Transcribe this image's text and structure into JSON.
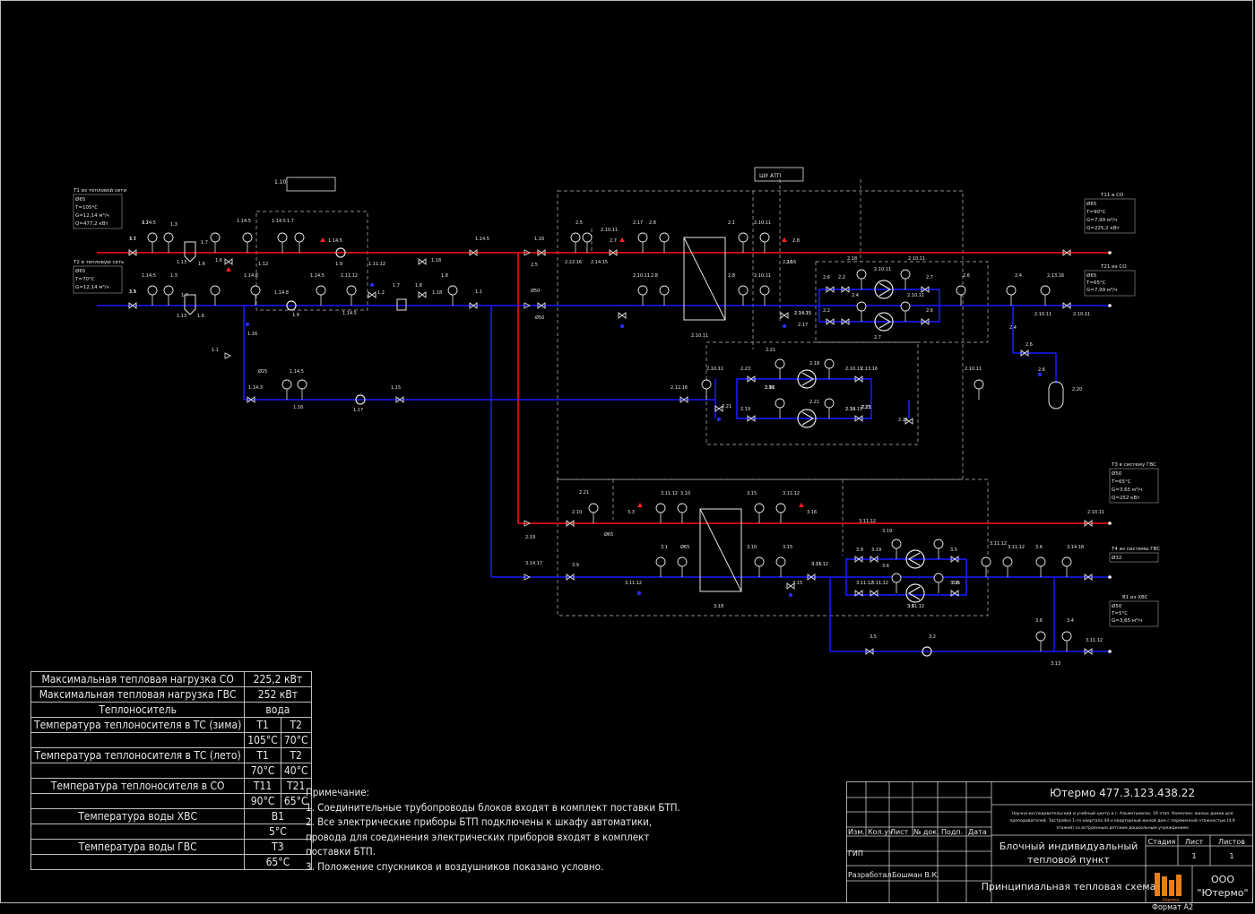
{
  "document": {
    "format_label": "Формат А2"
  },
  "colors": {
    "supply_line": "#ff0000",
    "return_line": "#0000ff",
    "drawing_lines": "#e6e6e6",
    "background": "#000000"
  },
  "params_table": {
    "rows": [
      {
        "label": "Максимальная тепловая нагрузка СО",
        "value": "225,2 кВт"
      },
      {
        "label": "Максимальная тепловая нагрузка ГВС",
        "value": "252 кВт"
      },
      {
        "label": "Теплоноситель",
        "value": "вода"
      },
      {
        "label": "Температура теплоносителя в ТС (зима)",
        "v1": "Т1",
        "v2": "Т2"
      },
      {
        "v1": "105°C",
        "v2": "70°C"
      },
      {
        "label": "Температура теплоносителя в ТС (лето)",
        "v1": "Т1",
        "v2": "Т2"
      },
      {
        "v1": "70°C",
        "v2": "40°C"
      },
      {
        "label": "Температура теплоносителя в СО",
        "v1": "Т11",
        "v2": "Т21"
      },
      {
        "v1": "90°C",
        "v2": "65°C"
      },
      {
        "label": "Температура воды ХВС",
        "value": "В1"
      },
      {
        "value": "5°C"
      },
      {
        "label": "Температура воды ГВС",
        "value": "Т3"
      },
      {
        "value": "65°C"
      }
    ]
  },
  "notes": {
    "title": "Примечание:",
    "lines": [
      "1. Соединительные трубопроводы блоков входят в комплект поставки БТП.",
      "2. Все электрические приборы БТП подключены к шкафу автоматики,",
      "провода для соединения электрических приборов входят в комплект",
      "поставки БТП.",
      "3. Положение спускников и воздушников показано условно."
    ]
  },
  "stamp": {
    "code": "Ютермо 477.3.123.438.22",
    "object": [
      "Научно-исследовательский и учебный центр в г. Альметьевске, 19 этап. Комплекс жилых домов для",
      "преподавателей. Застройка 1-го квартала 44-х квартирный жилой дом с переменной этажностью (4,9",
      "этажей) со встроенным детским дошкольным учреждением"
    ],
    "headers": [
      "Изм.",
      "Кол.уч",
      "Лист",
      "№ док.",
      "Подп.",
      "Дата"
    ],
    "role_gip": "ГИП",
    "role_dev": "Разработал",
    "dev_name": "Бошман В.К.",
    "title_line1": "Блочный индивидуальный",
    "title_line2": "тепловой пункт",
    "stage_label": "Стадия",
    "sheet_label": "Лист",
    "sheets_label": "Листов",
    "sheet_value": "1",
    "sheets_value": "1",
    "drawing_name": "Принципиальная тепловая схема",
    "company_line1": "ООО",
    "company_line2": "\"Ютермо\"",
    "logo_text": "Utermo"
  },
  "scheme": {
    "box_top": "1.10",
    "box_atp": "ШУ АТП",
    "t1_in": {
      "title": "Т1 из тепловой сети",
      "lines": [
        "Ø65",
        "T=105°C",
        "G=12,14 м³/ч",
        "Q=477,2 кВт"
      ]
    },
    "t2_out": {
      "title": "Т2 в тепловую сеть",
      "lines": [
        "Ø65",
        "T=70°C",
        "G=12,14 м³/ч"
      ]
    },
    "t11_out": {
      "title": "Т11 в СО",
      "lines": [
        "Ø65",
        "T=90°C",
        "G=7,99 м³/ч",
        "Q=225,2 кВт"
      ]
    },
    "t21_in": {
      "title": "Т21 из СО",
      "lines": [
        "Ø65",
        "T=65°C",
        "G=7,99 м³/ч"
      ]
    },
    "t3_out": {
      "title": "Т3 в систему ГВС",
      "lines": [
        "Ø50",
        "T=65°C",
        "G=3,65 м³/ч",
        "Q=252 кВт"
      ]
    },
    "t4_in": {
      "title": "Т4 из системы ГВС",
      "lines": [
        "Ø32"
      ]
    },
    "b1_in": {
      "title": "В1 из ХВС",
      "lines": [
        "Ø50",
        "T=5°C",
        "G=3,65 м³/ч"
      ]
    },
    "labels": [
      "1.1",
      "1.1",
      "1.14.5",
      "1.3",
      "1.7",
      "1.14.5",
      "1.3",
      "1.7",
      "1.13",
      "1.6",
      "1.13",
      "1.6",
      "1.6",
      "1.16",
      "1.14.5",
      "1.14.5",
      "1.14.8",
      "1.7",
      "1.12",
      "1.9",
      "1.11.12",
      "1.14.5",
      "1.14.8",
      "1.11.12",
      "1.9",
      "1.14.5",
      "1.14.5",
      "1.2",
      "1.7",
      "1.18",
      "1.8",
      "1.18",
      "1.8",
      "1.14.5",
      "1.1",
      "1.1",
      "Ø25",
      "1.14.5",
      "1.14.3",
      "1.16",
      "1.17",
      "1.15",
      "1.16",
      "2.5",
      "Ø50",
      "Ø50",
      "2.5",
      "2.22.16",
      "2.14.15",
      "2.10.11",
      "2.7",
      "2.16",
      "2.14.15",
      "2.17",
      "2.8",
      "2.10.11",
      "2.8",
      "2.10.11",
      "2.1",
      "2.10.11",
      "2.8",
      "2.10.11",
      "2.8",
      "2.16",
      "2.14.15",
      "2.17",
      "2.18",
      "2.10.11",
      "2.10.11",
      "2.2",
      "2.7",
      "2.4",
      "2.6",
      "2.10.11",
      "2.7",
      "2.6",
      "2.2",
      "2.6",
      "2.4",
      "2.13.16",
      "2.10.11",
      "2.10.11",
      "2.4",
      "2.6",
      "2.6",
      "2.20",
      "2.21",
      "2.18",
      "2.9",
      "2.10.11",
      "2.23",
      "2.10.11",
      "2.13.16",
      "2.21",
      "2.19",
      "2.21",
      "2.10.11",
      "2.19",
      "2.21",
      "2.12.16",
      "2.21",
      "2.18",
      "2.21",
      "2.3",
      "2.10.11",
      "2.23",
      "2.10.11",
      "2.19",
      "2.21",
      "2.10",
      "Ø65",
      "3.11.12",
      "3.10",
      "3.3",
      "3.15",
      "3.11.12",
      "3.16",
      "3.11.12",
      "3.15",
      "3.18",
      "3.14.17",
      "3.9",
      "3.1",
      "Ø65",
      "3.10",
      "3.15",
      "3.11.12",
      "3.11.12",
      "3.15",
      "3.9",
      "3.19",
      "3.19",
      "3.6",
      "3.5",
      "3.11.12",
      "3.11.12",
      "3.6",
      "3.14.18",
      "3.15",
      "3.11.12",
      "3.11.12",
      "3.6",
      "3.6",
      "3.5",
      "3.2",
      "3.6",
      "3.4",
      "3.13",
      "3.11.12",
      "3.11.12",
      "3.7",
      "3.9",
      "3.2"
    ]
  }
}
